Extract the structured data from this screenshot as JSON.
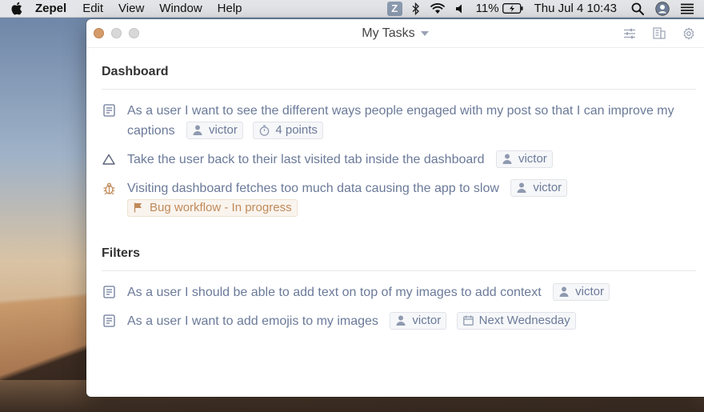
{
  "menubar": {
    "app_name": "Zepel",
    "menus": [
      "Edit",
      "View",
      "Window",
      "Help"
    ],
    "tray_zepel": "Z",
    "battery": "11%",
    "clock": "Thu Jul 4  10:43",
    "icons": [
      "apple-icon",
      "zepel-tray-icon",
      "bluetooth-icon",
      "wifi-icon",
      "volume-icon",
      "battery-charging-icon",
      "search-icon",
      "user-account-icon",
      "menu-list-icon"
    ]
  },
  "window": {
    "title": "My Tasks",
    "actions": [
      "sliders-icon",
      "building-icon",
      "gear-icon"
    ]
  },
  "sections": [
    {
      "title": "Dashboard",
      "tasks": [
        {
          "type": "story",
          "title": "As a user I want to see the different ways people engaged with my post so that I can improve my captions",
          "assignee": "victor",
          "points": "4 points"
        },
        {
          "type": "improvement",
          "title": "Take the user back to their last visited tab inside the dashboard",
          "assignee": "victor"
        },
        {
          "type": "bug",
          "title": "Visiting dashboard fetches too much data causing the app to slow",
          "assignee": "victor",
          "workflow": "Bug workflow - In progress"
        }
      ]
    },
    {
      "title": "Filters",
      "tasks": [
        {
          "type": "story",
          "title": "As a user I should be able to add text on top of my images to add context",
          "assignee": "victor"
        },
        {
          "type": "story",
          "title": "As a user I want to add emojis to my images",
          "assignee": "victor",
          "due": "Next Wednesday"
        }
      ]
    }
  ],
  "colors": {
    "task_text": "#6b7a99",
    "bug_accent": "#c08a5a",
    "window_close": "#d49b6b"
  }
}
